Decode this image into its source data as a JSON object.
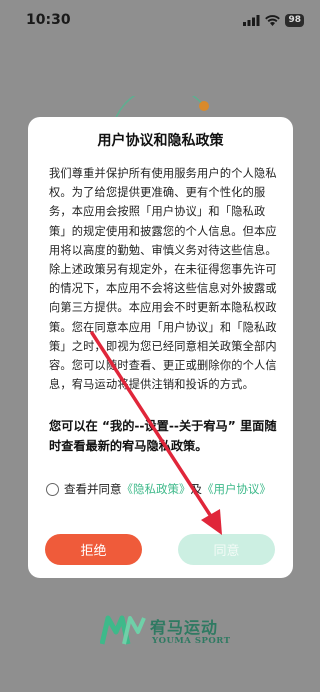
{
  "status_bar": {
    "time": "10:30",
    "battery": "98"
  },
  "dialog": {
    "title": "用户协议和隐私政策",
    "body": "我们尊重并保护所有使用服务用户的个人隐私权。为了给您提供更准确、更有个性化的服务，本应用会按照「用户协议」和「隐私政策」的规定使用和披露您的个人信息。但本应用将以高度的勤勉、审慎义务对待这些信息。除上述政策另有规定外，在未征得您事先许可的情况下，本应用不会将这些信息对外披露或向第三方提供。本应用会不时更新本隐私权政策。您在同意本应用「用户协议」和「隐私政策」之时，即视为您已经同意相关政策全部内容。您可以随时查看、更正或删除你的个人信息，宥马运动将提供注销和投诉的方式。",
    "notice": "您可以在 “我的--设置--关于宥马” 里面随时查看最新的宥马隐私政策。",
    "agree_prefix": "查看并同意",
    "privacy_link": "《隐私政策》",
    "agree_and": "及",
    "terms_link": "《用户协议》",
    "reject_label": "拒绝",
    "accept_label": "同意"
  },
  "logo": {
    "name_cn": "宥马运动",
    "name_en": "YOUMA SPORT"
  },
  "colors": {
    "accent": "#3eb98a",
    "reject": "#ef5b3a",
    "accept_disabled": "#ccefe2",
    "arrow": "#e0263a"
  }
}
